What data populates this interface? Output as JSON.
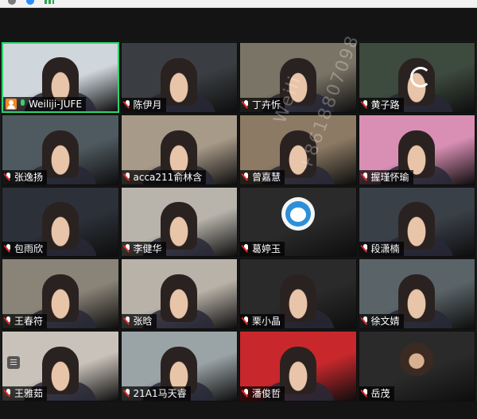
{
  "watermark": {
    "line1": "Weili",
    "line2": "+8618807098"
  },
  "tiles": [
    {
      "name": "Weiliji-JUFE",
      "mic": "on",
      "host": true,
      "active": true,
      "bg": "#cfd6dc"
    },
    {
      "name": "陈伊月",
      "mic": "muted",
      "bg": "#3a3e42"
    },
    {
      "name": "丁卉忻",
      "mic": "muted",
      "bg": "#7a7466"
    },
    {
      "name": "黄子路",
      "mic": "muted",
      "bg": "#3d4a3e",
      "loading": true
    },
    {
      "name": "张逸扬",
      "mic": "muted",
      "bg": "#4f5a60"
    },
    {
      "name": "acca211俞林含",
      "mic": "muted",
      "bg": "#a89a88"
    },
    {
      "name": "曾嘉慧",
      "mic": "muted",
      "bg": "#8c7a64"
    },
    {
      "name": "握瑾怀瑜",
      "mic": "muted",
      "bg": "#d98fb4"
    },
    {
      "name": "包雨欣",
      "mic": "muted",
      "bg": "#2c3038"
    },
    {
      "name": "李健华",
      "mic": "muted",
      "bg": "#b8b4ac"
    },
    {
      "name": "葛婷玉",
      "mic": "muted",
      "bg": "#2a2a2a",
      "avatar": "dora"
    },
    {
      "name": "段潇楠",
      "mic": "muted",
      "bg": "#3a4048"
    },
    {
      "name": "王春符",
      "mic": "muted",
      "bg": "#8a8478"
    },
    {
      "name": "张晗",
      "mic": "muted",
      "bg": "#b9b2a8"
    },
    {
      "name": "栗小晶",
      "mic": "muted",
      "bg": "#2a2a2a"
    },
    {
      "name": "徐文婧",
      "mic": "muted",
      "bg": "#5a6468"
    },
    {
      "name": "王雅茹",
      "mic": "muted",
      "bg": "#c9c2ba",
      "menu": true
    },
    {
      "name": "21A1马天睿",
      "mic": "muted",
      "bg": "#9aa3a6"
    },
    {
      "name": "潘俊哲",
      "mic": "muted",
      "bg": "#c8282c"
    },
    {
      "name": "岳茂",
      "mic": "muted",
      "bg": "#2a2a2a",
      "avatar": "photo"
    }
  ]
}
